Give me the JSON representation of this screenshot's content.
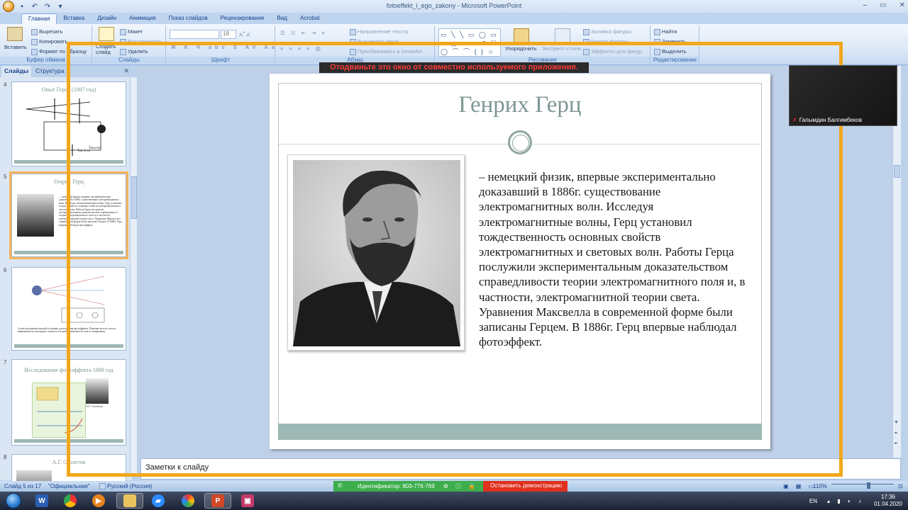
{
  "window": {
    "title": "fotoeffekt_i_ego_zakony - Microsoft PowerPoint",
    "controls": [
      "–",
      "▭",
      "✕"
    ]
  },
  "ribbon": {
    "tabs": [
      "Главная",
      "Вставка",
      "Дизайн",
      "Анимация",
      "Показ слайдов",
      "Рецензирование",
      "Вид",
      "Acrobat"
    ],
    "active_tab": "Главная",
    "clipboard": {
      "paste": "Вставить",
      "cut": "Вырезать",
      "copy": "Копировать",
      "format_painter": "Формат по образцу",
      "label": "Буфер обмена"
    },
    "slides": {
      "new_slide": "Создать слайд",
      "layout": "Макет",
      "reset": "Восстановить",
      "delete": "Удалить",
      "label": "Слайды"
    },
    "font": {
      "font_size": "18",
      "label": "Шрифт"
    },
    "paragraph": {
      "text_direction": "Направление текста",
      "align_text": "Выровнять текст",
      "smartart": "Преобразовать в SmartArt",
      "label": "Абзац"
    },
    "drawing": {
      "arrange": "Упорядочить",
      "quick_styles": "Экспресс-стили",
      "shape_fill": "Заливка фигуры",
      "shape_outline": "Контур фигуры",
      "shape_effects": "Эффекты для фигур",
      "label": "Рисование"
    },
    "editing": {
      "find": "Найти",
      "replace": "Заменить",
      "select": "Выделить",
      "label": "Редактирование"
    }
  },
  "left_pane": {
    "tabs": [
      "Слайды",
      "Структура"
    ],
    "close": "✕",
    "thumbnails": [
      {
        "number": "4",
        "title": "Опыт Герца (1887 год)",
        "labels": [
          "Ток есть",
          "Тока нет"
        ]
      },
      {
        "number": "5",
        "title": "Генрих Герц",
        "text": "— немецкий физик, впервые экспериментально доказавший в 1886г. существование электромагнитных волн. Исследуя электромагнитные волны, Герц установил тождественность основных свойств электромагнитных и световых волн. Работы Герца послужили экспериментальным доказательством справедливости теории электромагнитного поля и, в частности, электромагнитной теории света. Уравнения Максвелла в современной форме были записаны Герцем. В 1886г. Герц впервые наблюдал фотоэффект."
      },
      {
        "number": "6",
        "text": "Схема экспериментальной установки для изучения фотоэффекта. Изменяя частоту света и напряжение на электродах, можно исследовать зависимость тока от напряжения."
      },
      {
        "number": "7",
        "title": "Исследование фотоэффекта 1888 год",
        "caption": "А.Г. Столетов"
      },
      {
        "number": "8",
        "title": "А.Г. Столетов"
      }
    ]
  },
  "slide": {
    "title": "Генрих Герц",
    "body": "– немецкий физик, впервые экспериментально доказавший в 1886г. существование электромагнитных волн. Исследуя электромагнитные волны, Герц установил тождественность основных свойств электромагнитных и световых волн. Работы Герца послужили экспериментальным доказательством справедливости теории электромагнитного поля и, в частности, электромагнитной теории света. Уравнения Максвелла в современной форме были записаны Герцем. В 1886г. Герц впервые наблюдал фотоэффект.",
    "photo_alt": "portrait-photo"
  },
  "notes_placeholder": "Заметки к слайду",
  "status": {
    "slide_counter": "Слайд 5 из 17",
    "theme": "\"Официальная\"",
    "language": "Русский (Россия)",
    "zoom": "110%"
  },
  "share": {
    "id_label": "Идентификатор: 803-776-769",
    "stop_label": "Остановить демонстрацию",
    "warning": "Отодвиньте это окно от совместно используемого приложения."
  },
  "video": {
    "name": "Галымдин Балгимбеков"
  },
  "taskbar": {
    "language": "EN",
    "time": "17:36",
    "date": "01.04.2020"
  }
}
